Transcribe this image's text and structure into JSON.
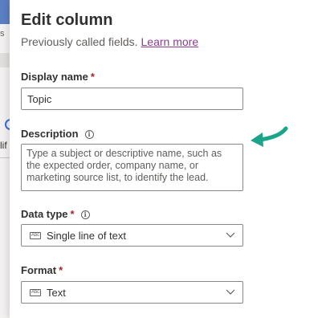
{
  "background": {
    "fragment_top": "s",
    "fragment_mid": "lif"
  },
  "panel": {
    "title": "Edit column",
    "subtitle": "Previously called fields.",
    "learn_more": "Learn more"
  },
  "fields": {
    "display_name": {
      "label": "Display name",
      "required": "*",
      "value": "Topic"
    },
    "description": {
      "label": "Description",
      "value": "Type a subject or descriptive name, such as the expected order, company name, or marketing source list, to identify the lead."
    },
    "data_type": {
      "label": "Data type",
      "required": "*",
      "value": "Single line of text",
      "icon_text": "Abc"
    },
    "format": {
      "label": "Format",
      "required": "*",
      "value": "Text",
      "icon_text": "Abc"
    }
  },
  "info_glyph": "i",
  "colors": {
    "accent_arrow": "#1aa58a",
    "link": "#8a3c8f",
    "required": "#a4262c"
  }
}
